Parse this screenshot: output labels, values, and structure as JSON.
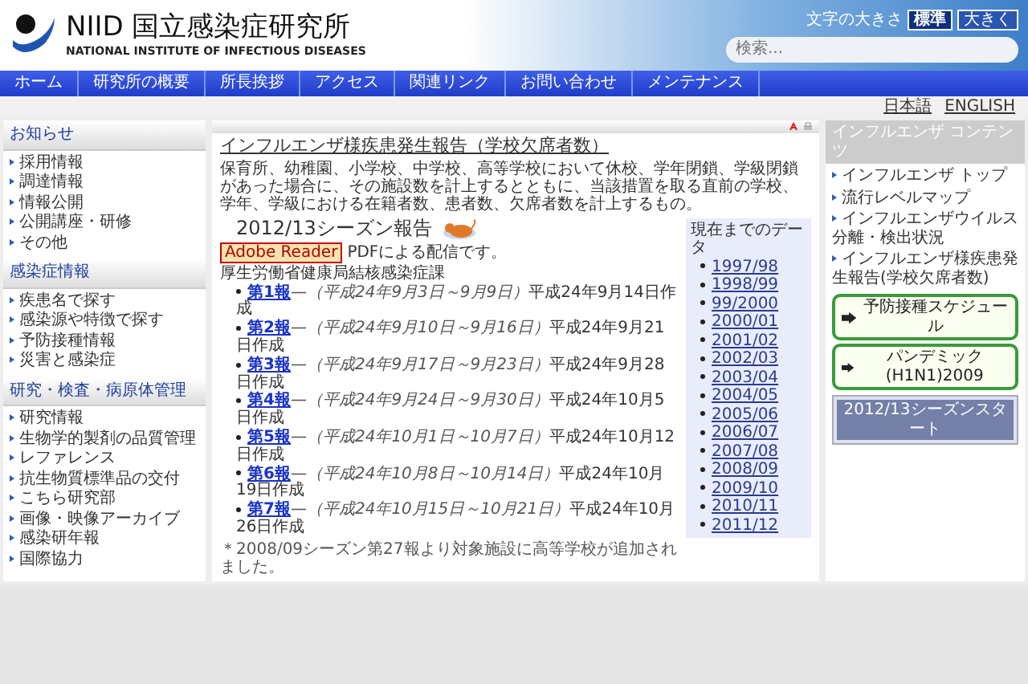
{
  "header": {
    "logo_text": "NIID 国立感染症研究所",
    "logo_subtitle": "NATIONAL INSTITUTE OF INFECTIOUS DISEASES",
    "font_size_label": "文字の大きさ",
    "font_buttons": [
      {
        "label": "標準",
        "selected": true
      },
      {
        "label": "大きく",
        "selected": false
      }
    ],
    "search": {
      "placeholder": "検索..."
    }
  },
  "nav": [
    "ホーム",
    "研究所の概要",
    "所長挨拶",
    "アクセス",
    "関連リンク",
    "お問い合わせ",
    "メンテナンス"
  ],
  "languages": [
    "日本語",
    "ENGLISH"
  ],
  "sidebar": [
    {
      "heading": "お知らせ",
      "items": [
        "採用情報",
        "調達情報",
        "情報公開",
        "公開講座・研修",
        "その他"
      ]
    },
    {
      "heading": "感染症情報",
      "items": [
        "疾患名で探す",
        "感染源や特徴で探す",
        "予防接種情報",
        "災害と感染症"
      ]
    },
    {
      "heading": "研究・検査・病原体管理",
      "items": [
        "研究情報",
        "生物学的製剤の品質管理",
        "レファレンス",
        "抗生物質標準品の交付",
        "こちら研究部",
        "画像・映像アーカイブ",
        "感染研年報",
        "国際協力"
      ]
    }
  ],
  "main": {
    "title": "インフルエンザ様疾患発生報告（学校欠席者数）",
    "description": "保育所、幼稚園、小学校、中学校、高等学校において休校、学年閉鎖、学級閉鎖があった場合に、その施設数を計上するとともに、当該措置を取る直前の学校、学年、学級における在籍者数、患者数、欠席者数を計上するもの。",
    "season_title": "2012/13シーズン報告",
    "reader_badge": "Adobe Reader",
    "pdf_note": "PDFによる配信です。",
    "source": "厚生労働省健康局結核感染症課",
    "reports": [
      {
        "link": "第1報",
        "period": "—（平成24年9月3日～9月9日）",
        "created": "平成24年9月14日作成"
      },
      {
        "link": "第2報",
        "period": "—（平成24年9月10日～9月16日）",
        "created": "平成24年9月21日作成"
      },
      {
        "link": "第3報",
        "period": "—（平成24年9月17日～9月23日）",
        "created": "平成24年9月28日作成"
      },
      {
        "link": "第4報",
        "period": "—（平成24年9月24日～9月30日）",
        "created": "平成24年10月5日作成"
      },
      {
        "link": "第5報",
        "period": "—（平成24年10月1日～10月7日）",
        "created": "平成24年10月12日作成"
      },
      {
        "link": "第6報",
        "period": "—（平成24年10月8日～10月14日）",
        "created": "平成24年10月19日作成"
      },
      {
        "link": "第7報",
        "period": "—（平成24年10月15日～10月21日）",
        "created": "平成24年10月26日作成"
      }
    ],
    "footnote": "＊2008/09シーズン第27報より対象施設に高等学校が追加されました。",
    "archive": {
      "heading": "現在までのデータ",
      "years": [
        "1997/98",
        "1998/99",
        "99/2000",
        "2000/01",
        "2001/02",
        "2002/03",
        "2003/04",
        "2004/05",
        "2005/06",
        "2006/07",
        "2007/08",
        "2008/09",
        "2009/10",
        "2010/11",
        "2011/12"
      ]
    }
  },
  "right": {
    "heading": "インフルエンザ コンテンツ",
    "items": [
      "インフルエンザ トップ",
      "流行レベルマップ",
      "インフルエンザウイルス分離・検出状況",
      "インフルエンザ様疾患発生報告(学校欠席者数)"
    ],
    "buttons": [
      "予防接種スケジュール",
      "パンデミック(H1N1)2009"
    ],
    "banner": "2012/13シーズンスタート"
  }
}
